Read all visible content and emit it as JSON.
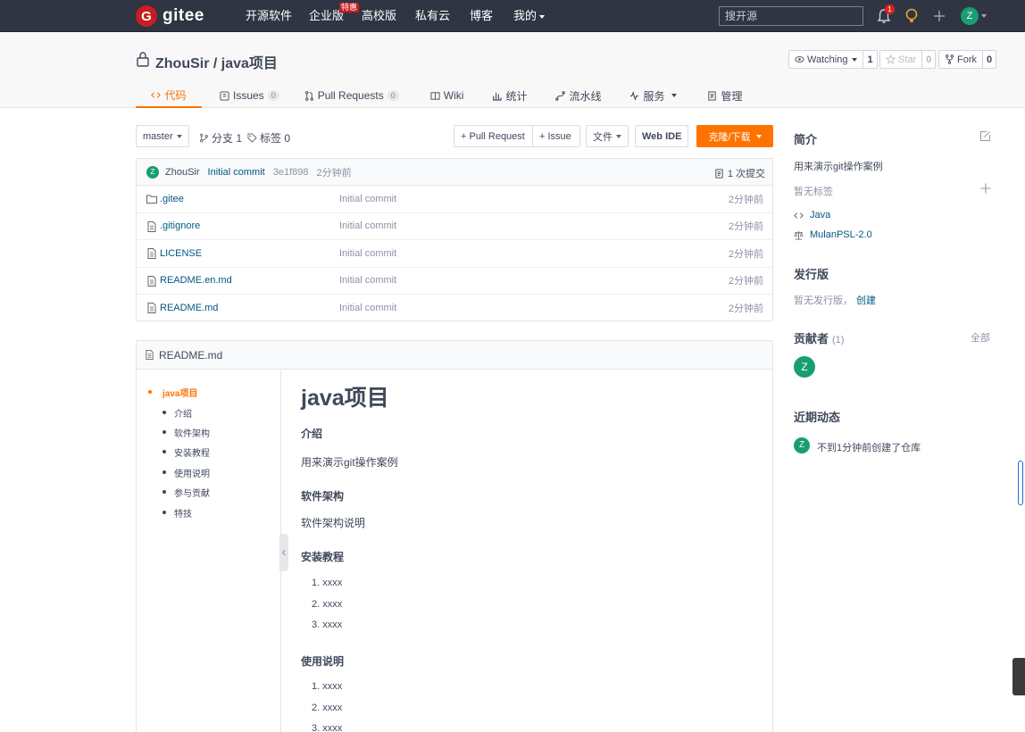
{
  "nav": {
    "logo_text": "gitee",
    "logo_mark": "G",
    "items": [
      "开源软件",
      "企业版",
      "高校版",
      "私有云",
      "博客",
      "我的"
    ],
    "hot_badge": "特惠",
    "search_placeholder": "搜开源",
    "notification_count": "1",
    "avatar_letter": "Z"
  },
  "repo": {
    "title": "ZhouSir / java项目",
    "watch_label": "Watching",
    "watch_count": "1",
    "star_label": "Star",
    "star_count": "0",
    "fork_label": "Fork",
    "fork_count": "0",
    "tabs": [
      {
        "label": "代码",
        "count": ""
      },
      {
        "label": "Issues",
        "count": "0"
      },
      {
        "label": "Pull Requests",
        "count": "0"
      },
      {
        "label": "Wiki",
        "count": ""
      },
      {
        "label": "统计",
        "count": ""
      },
      {
        "label": "流水线",
        "count": ""
      },
      {
        "label": "服务",
        "count": ""
      },
      {
        "label": "管理",
        "count": ""
      }
    ]
  },
  "toolbar": {
    "branch": "master",
    "branches": "分支 1",
    "tags": "标签 0",
    "pull_request": "+ Pull Request",
    "issue": "+ Issue",
    "file": "文件",
    "web_ide": "Web IDE",
    "clone": "克隆/下载"
  },
  "commit": {
    "avatar": "Z",
    "author": "ZhouSir",
    "message": "Initial commit",
    "hash": "3e1f898",
    "time": "2分钟前",
    "count": "1 次提交"
  },
  "files": [
    {
      "name": ".gitee",
      "type": "folder",
      "message": "Initial commit",
      "time": "2分钟前"
    },
    {
      "name": ".gitignore",
      "type": "file",
      "message": "Initial commit",
      "time": "2分钟前"
    },
    {
      "name": "LICENSE",
      "type": "file",
      "message": "Initial commit",
      "time": "2分钟前"
    },
    {
      "name": "README.en.md",
      "type": "file",
      "message": "Initial commit",
      "time": "2分钟前"
    },
    {
      "name": "README.md",
      "type": "file",
      "message": "Initial commit",
      "time": "2分钟前"
    }
  ],
  "readme": {
    "filename": "README.md",
    "toc": [
      "java项目",
      "介绍",
      "软件架构",
      "安装教程",
      "使用说明",
      "参与贡献",
      "特技"
    ],
    "title": "java项目",
    "intro_h": "介绍",
    "intro_p": "用来演示git操作案例",
    "arch_h": "软件架构",
    "arch_p": "软件架构说明",
    "install_h": "安装教程",
    "install_items": [
      "1. xxxx",
      "2. xxxx",
      "3. xxxx"
    ],
    "usage_h": "使用说明",
    "usage_items": [
      "1. xxxx",
      "2. xxxx",
      "3. xxxx"
    ]
  },
  "sidebar": {
    "intro_h": "简介",
    "intro_text": "用来演示git操作案例",
    "no_tags": "暂无标签",
    "language": "Java",
    "license": "MulanPSL-2.0",
    "release_h": "发行版",
    "release_text": "暂无发行版，",
    "release_link": "创建",
    "contrib_h": "贡献者",
    "contrib_count": "(1)",
    "contrib_all": "全部",
    "contrib_avatar": "Z",
    "activity_h": "近期动态",
    "activity_avatar": "Z",
    "activity_text": "不到1分钟前创建了仓库"
  },
  "colors": {
    "accent": "#fe7300",
    "nav_bg": "#2f3542",
    "brand_red": "#c71d23",
    "avatar_green": "#189e72",
    "link": "#005980"
  }
}
